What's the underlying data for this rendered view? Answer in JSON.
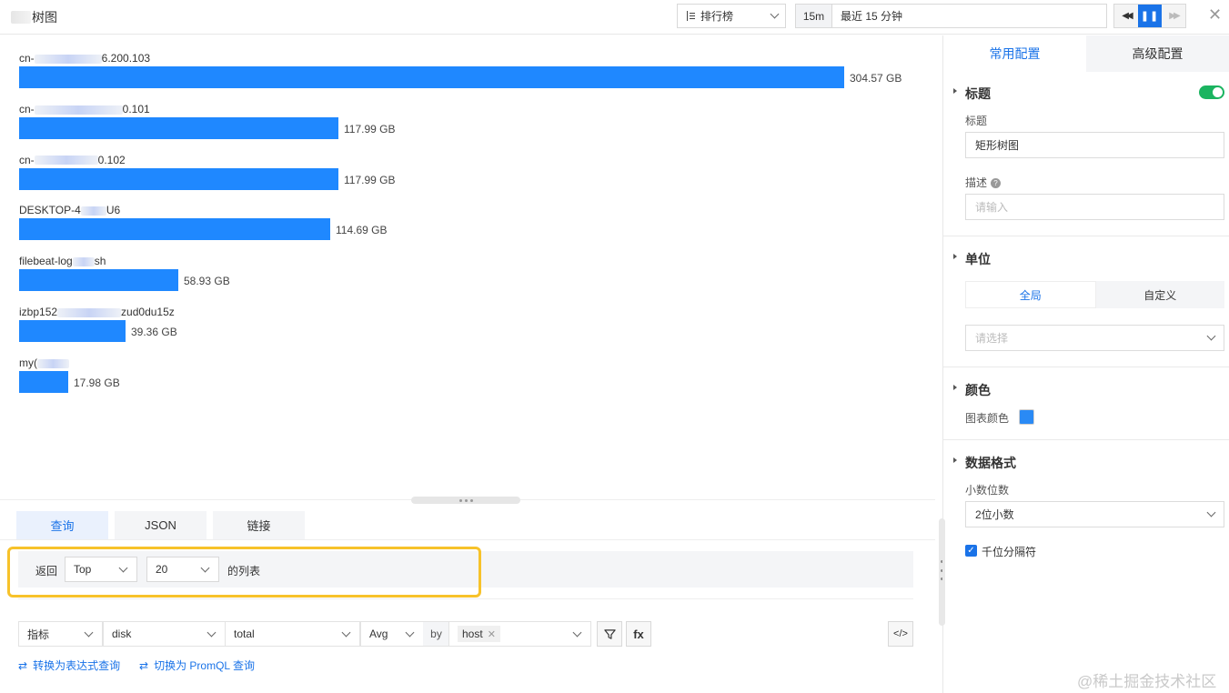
{
  "header": {
    "title": "树图",
    "sort_label": "排行榜",
    "range_short": "15m",
    "range_long": "最近 15 分钟",
    "close_label": "✕"
  },
  "chart_data": {
    "type": "bar",
    "orientation": "horizontal",
    "categories": [
      "cn-6.200.103",
      "cn-0.101",
      "cn-0.102",
      "DESKTOP-4U6",
      "filebeat-logsh",
      "izbp152zud0du15z",
      "my("
    ],
    "values": [
      304.57,
      117.99,
      117.99,
      114.69,
      58.93,
      39.36,
      17.98
    ],
    "value_labels": [
      "304.57 GB",
      "117.99 GB",
      "117.99 GB",
      "114.69 GB",
      "58.93 GB",
      "39.36 GB",
      "17.98 GB"
    ],
    "unit": "GB",
    "color": "#1f88ff",
    "label_parts": [
      {
        "pre": "cn-",
        "post": "6.200.103"
      },
      {
        "pre": "cn-",
        "post": "0.101"
      },
      {
        "pre": "cn-",
        "post": "0.102"
      },
      {
        "pre": "DESKTOP-4",
        "post": "U6"
      },
      {
        "pre": "filebeat-log",
        "post": "sh"
      },
      {
        "pre": "izbp152",
        "post": "zud0du15z"
      },
      {
        "pre": "my(",
        "post": ""
      }
    ]
  },
  "query": {
    "tabs": [
      "查询",
      "JSON",
      "链接"
    ],
    "return_label": "返回",
    "top_value": "Top",
    "count_value": "20",
    "list_suffix": "的列表",
    "metric_type": "指标",
    "measurement": "disk",
    "field": "total",
    "aggregate": "Avg",
    "by_label": "by",
    "group_tag": "host",
    "fx_label": "fx",
    "code_label": "</>",
    "link_expr": "转换为表达式查询",
    "link_promql": "切换为 PromQL 查询"
  },
  "config": {
    "tabs": [
      "常用配置",
      "高级配置"
    ],
    "title_section": "标题",
    "title_field_label": "标题",
    "title_value": "矩形树图",
    "desc_label": "描述",
    "desc_placeholder": "请输入",
    "unit_section": "单位",
    "unit_global": "全局",
    "unit_custom": "自定义",
    "unit_placeholder": "请选择",
    "color_section": "颜色",
    "chart_color_label": "图表颜色",
    "chart_color": "#2a8af5",
    "format_section": "数据格式",
    "decimals_label": "小数位数",
    "decimals_value": "2位小数",
    "thousands_label": "千位分隔符"
  },
  "watermark": "@稀土掘金技术社区"
}
